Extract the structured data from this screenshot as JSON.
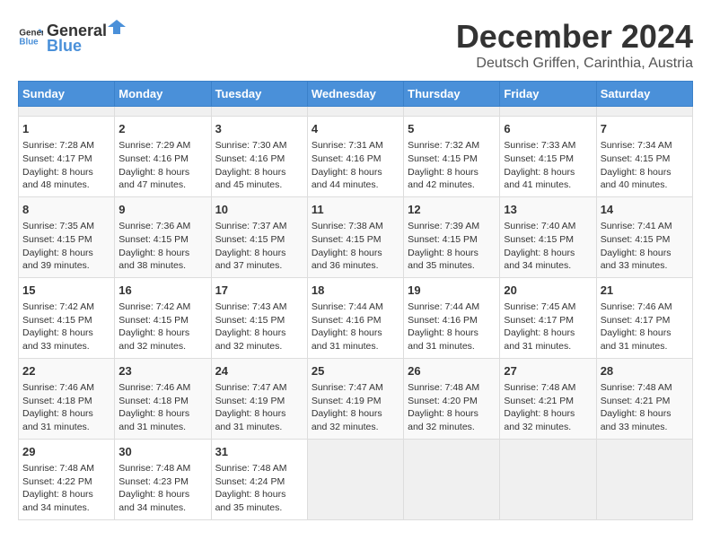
{
  "header": {
    "logo_general": "General",
    "logo_blue": "Blue",
    "title": "December 2024",
    "subtitle": "Deutsch Griffen, Carinthia, Austria"
  },
  "calendar": {
    "days_of_week": [
      "Sunday",
      "Monday",
      "Tuesday",
      "Wednesday",
      "Thursday",
      "Friday",
      "Saturday"
    ],
    "weeks": [
      [
        {
          "day": "",
          "empty": true
        },
        {
          "day": "",
          "empty": true
        },
        {
          "day": "",
          "empty": true
        },
        {
          "day": "",
          "empty": true
        },
        {
          "day": "",
          "empty": true
        },
        {
          "day": "",
          "empty": true
        },
        {
          "day": "",
          "empty": true
        }
      ],
      [
        {
          "day": "1",
          "sunrise": "7:28 AM",
          "sunset": "4:17 PM",
          "daylight": "8 hours and 48 minutes."
        },
        {
          "day": "2",
          "sunrise": "7:29 AM",
          "sunset": "4:16 PM",
          "daylight": "8 hours and 47 minutes."
        },
        {
          "day": "3",
          "sunrise": "7:30 AM",
          "sunset": "4:16 PM",
          "daylight": "8 hours and 45 minutes."
        },
        {
          "day": "4",
          "sunrise": "7:31 AM",
          "sunset": "4:16 PM",
          "daylight": "8 hours and 44 minutes."
        },
        {
          "day": "5",
          "sunrise": "7:32 AM",
          "sunset": "4:15 PM",
          "daylight": "8 hours and 42 minutes."
        },
        {
          "day": "6",
          "sunrise": "7:33 AM",
          "sunset": "4:15 PM",
          "daylight": "8 hours and 41 minutes."
        },
        {
          "day": "7",
          "sunrise": "7:34 AM",
          "sunset": "4:15 PM",
          "daylight": "8 hours and 40 minutes."
        }
      ],
      [
        {
          "day": "8",
          "sunrise": "7:35 AM",
          "sunset": "4:15 PM",
          "daylight": "8 hours and 39 minutes."
        },
        {
          "day": "9",
          "sunrise": "7:36 AM",
          "sunset": "4:15 PM",
          "daylight": "8 hours and 38 minutes."
        },
        {
          "day": "10",
          "sunrise": "7:37 AM",
          "sunset": "4:15 PM",
          "daylight": "8 hours and 37 minutes."
        },
        {
          "day": "11",
          "sunrise": "7:38 AM",
          "sunset": "4:15 PM",
          "daylight": "8 hours and 36 minutes."
        },
        {
          "day": "12",
          "sunrise": "7:39 AM",
          "sunset": "4:15 PM",
          "daylight": "8 hours and 35 minutes."
        },
        {
          "day": "13",
          "sunrise": "7:40 AM",
          "sunset": "4:15 PM",
          "daylight": "8 hours and 34 minutes."
        },
        {
          "day": "14",
          "sunrise": "7:41 AM",
          "sunset": "4:15 PM",
          "daylight": "8 hours and 33 minutes."
        }
      ],
      [
        {
          "day": "15",
          "sunrise": "7:42 AM",
          "sunset": "4:15 PM",
          "daylight": "8 hours and 33 minutes."
        },
        {
          "day": "16",
          "sunrise": "7:42 AM",
          "sunset": "4:15 PM",
          "daylight": "8 hours and 32 minutes."
        },
        {
          "day": "17",
          "sunrise": "7:43 AM",
          "sunset": "4:15 PM",
          "daylight": "8 hours and 32 minutes."
        },
        {
          "day": "18",
          "sunrise": "7:44 AM",
          "sunset": "4:16 PM",
          "daylight": "8 hours and 31 minutes."
        },
        {
          "day": "19",
          "sunrise": "7:44 AM",
          "sunset": "4:16 PM",
          "daylight": "8 hours and 31 minutes."
        },
        {
          "day": "20",
          "sunrise": "7:45 AM",
          "sunset": "4:17 PM",
          "daylight": "8 hours and 31 minutes."
        },
        {
          "day": "21",
          "sunrise": "7:46 AM",
          "sunset": "4:17 PM",
          "daylight": "8 hours and 31 minutes."
        }
      ],
      [
        {
          "day": "22",
          "sunrise": "7:46 AM",
          "sunset": "4:18 PM",
          "daylight": "8 hours and 31 minutes."
        },
        {
          "day": "23",
          "sunrise": "7:46 AM",
          "sunset": "4:18 PM",
          "daylight": "8 hours and 31 minutes."
        },
        {
          "day": "24",
          "sunrise": "7:47 AM",
          "sunset": "4:19 PM",
          "daylight": "8 hours and 31 minutes."
        },
        {
          "day": "25",
          "sunrise": "7:47 AM",
          "sunset": "4:19 PM",
          "daylight": "8 hours and 32 minutes."
        },
        {
          "day": "26",
          "sunrise": "7:48 AM",
          "sunset": "4:20 PM",
          "daylight": "8 hours and 32 minutes."
        },
        {
          "day": "27",
          "sunrise": "7:48 AM",
          "sunset": "4:21 PM",
          "daylight": "8 hours and 32 minutes."
        },
        {
          "day": "28",
          "sunrise": "7:48 AM",
          "sunset": "4:21 PM",
          "daylight": "8 hours and 33 minutes."
        }
      ],
      [
        {
          "day": "29",
          "sunrise": "7:48 AM",
          "sunset": "4:22 PM",
          "daylight": "8 hours and 34 minutes."
        },
        {
          "day": "30",
          "sunrise": "7:48 AM",
          "sunset": "4:23 PM",
          "daylight": "8 hours and 34 minutes."
        },
        {
          "day": "31",
          "sunrise": "7:48 AM",
          "sunset": "4:24 PM",
          "daylight": "8 hours and 35 minutes."
        },
        {
          "day": "",
          "empty": true
        },
        {
          "day": "",
          "empty": true
        },
        {
          "day": "",
          "empty": true
        },
        {
          "day": "",
          "empty": true
        }
      ]
    ]
  }
}
